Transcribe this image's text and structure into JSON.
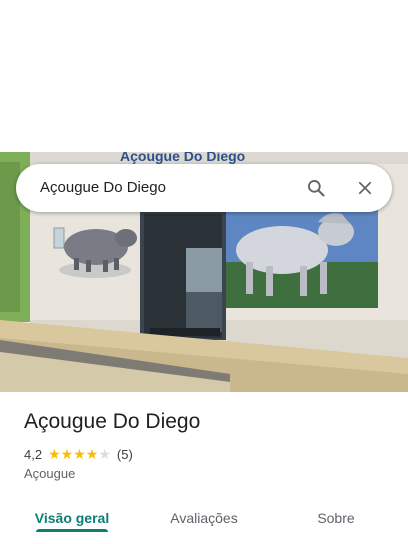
{
  "search": {
    "query": "Açougue Do Diego"
  },
  "header": {
    "sign_text": "Açougue Do Diego"
  },
  "place": {
    "title": "Açougue Do Diego",
    "rating": "4,2",
    "stars_filled": 4,
    "stars_total": 5,
    "review_count": "(5)",
    "category": "Açougue"
  },
  "tabs": [
    {
      "label": "Visão geral",
      "active": true
    },
    {
      "label": "Avaliações",
      "active": false
    },
    {
      "label": "Sobre",
      "active": false
    }
  ],
  "icons": {
    "search": "search-icon",
    "close": "close-icon",
    "star": "star-icon"
  },
  "colors": {
    "accent": "#0b7f74",
    "star": "#fbbc04",
    "wall": "#e9e5dd",
    "green_wall": "#7fae58"
  }
}
